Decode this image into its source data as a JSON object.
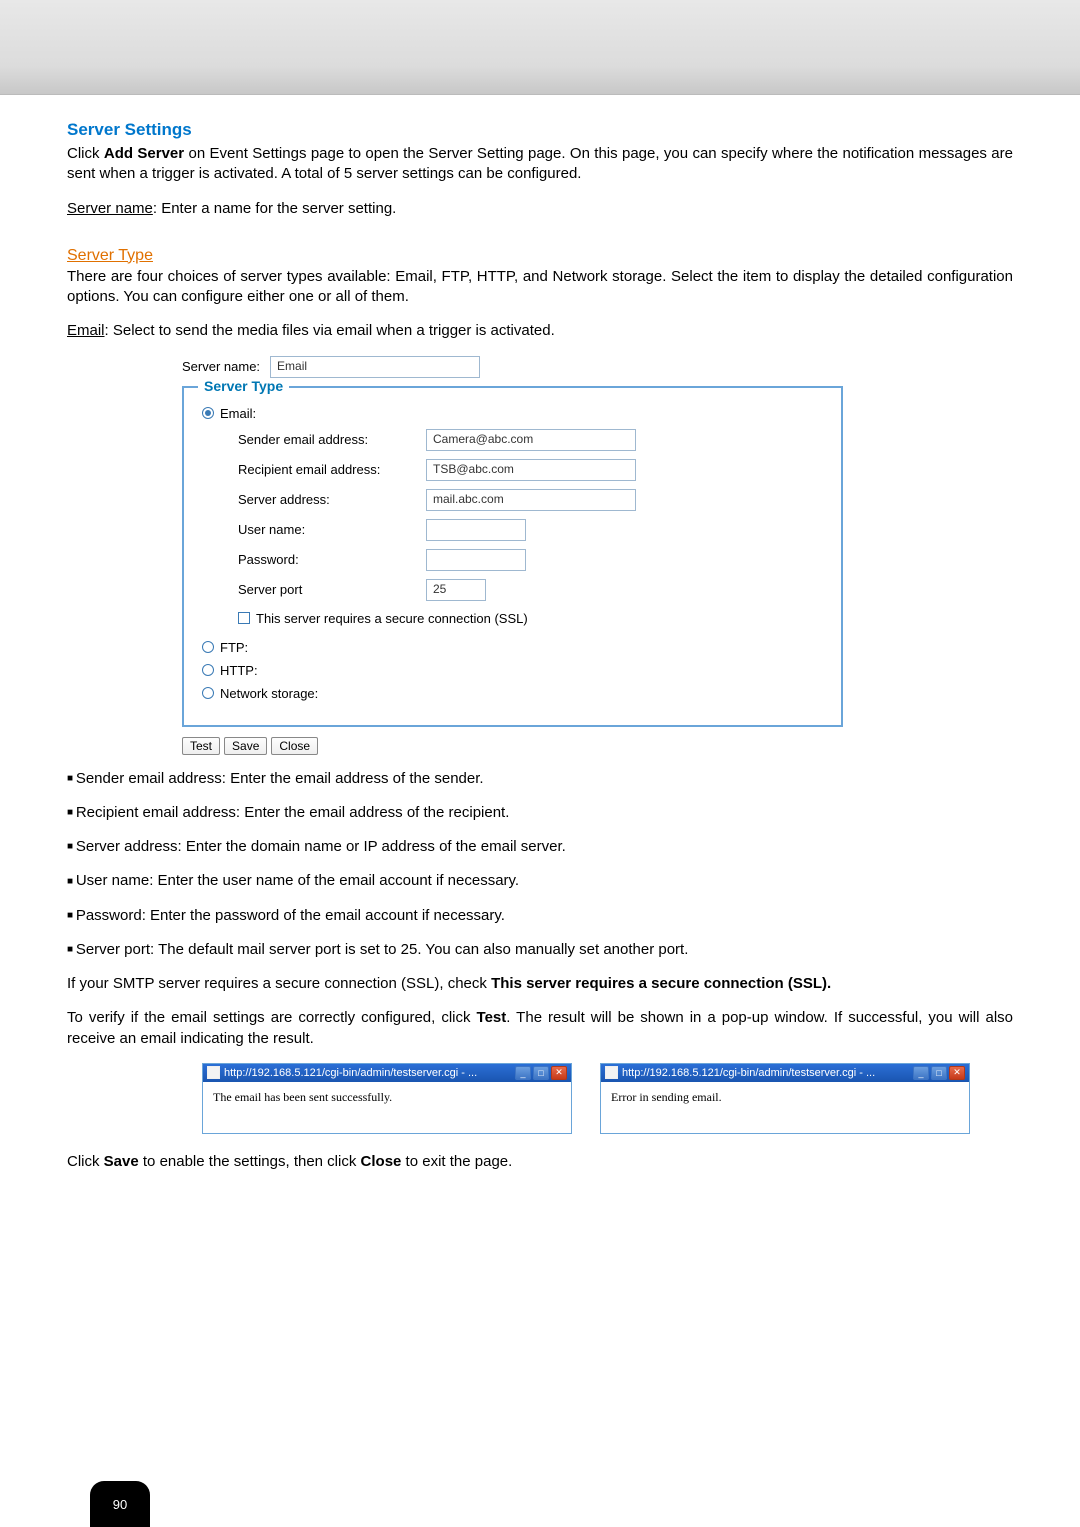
{
  "headings": {
    "serverSettings": "Server Settings",
    "serverType": "Server Type"
  },
  "intro": {
    "p1_prefix": "Click ",
    "p1_addServer": "Add Server",
    "p1_suffix": " on Event Settings page to open the Server Setting page. On this page, you can specify where the notification messages are sent when a trigger is activated. A total of 5 server settings can be configured.",
    "serverNameLabel": "Server name",
    "serverNameText": ": Enter a name for the server setting.",
    "typesText": "There are four choices of server types available: Email, FTP, HTTP, and Network storage. Select the item to display the detailed configuration options. You can configure either one or all of them.",
    "emailLabel": "Email",
    "emailText": ": Select to send the media files via email when a trigger is activated."
  },
  "form": {
    "serverNameLabel": "Server name:",
    "serverNameValue": "Email",
    "legend": "Server Type",
    "radioEmail": "Email:",
    "radioFtp": "FTP:",
    "radioHttp": "HTTP:",
    "radioNetwork": "Network storage:",
    "senderLabel": "Sender email address:",
    "senderValue": "Camera@abc.com",
    "recipientLabel": "Recipient email address:",
    "recipientValue": "TSB@abc.com",
    "serverAddrLabel": "Server address:",
    "serverAddrValue": "mail.abc.com",
    "userLabel": "User name:",
    "userValue": "",
    "passLabel": "Password:",
    "passValue": "",
    "portLabel": "Server port",
    "portValue": "25",
    "sslLabel": "This server requires a secure connection (SSL)"
  },
  "buttons": {
    "test": "Test",
    "save": "Save",
    "close": "Close"
  },
  "bullets": [
    "Sender email address: Enter the email address of the sender.",
    "Recipient email address: Enter the email address of the recipient.",
    "Server address: Enter the domain name or IP address of the email server.",
    "User name: Enter the user name of the email account if necessary.",
    "Password: Enter the password of the email account if necessary.",
    "Server port: The default mail server port is set to 25. You can also manually set another port."
  ],
  "ssl": {
    "prefix": "If your SMTP server requires a secure connection (SSL), check ",
    "bold": "This server requires a secure connection (SSL)."
  },
  "verify": {
    "prefix": "To verify if the email settings are correctly configured, click ",
    "test": "Test",
    "suffix": ". The result will be shown in a pop-up window. If successful, you will also receive an email indicating the result."
  },
  "popups": {
    "title": "http://192.168.5.121/cgi-bin/admin/testserver.cgi - ...",
    "successMsg": "The email has been sent successfully.",
    "errorMsg": "Error in sending email."
  },
  "closing": {
    "prefix": "Click ",
    "save": "Save",
    "mid": " to enable the settings, then click ",
    "close": "Close",
    "suffix": " to exit the page."
  },
  "pageNumber": "90"
}
